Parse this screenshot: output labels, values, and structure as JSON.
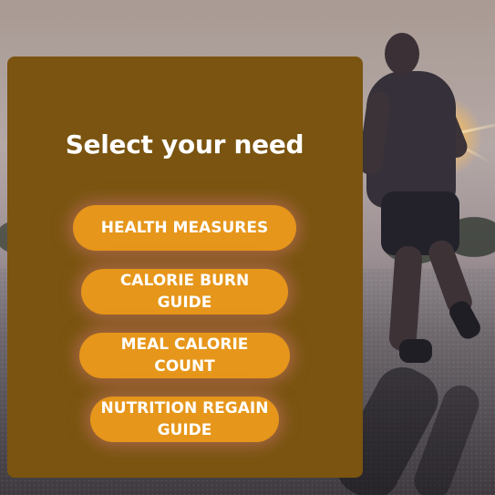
{
  "panel": {
    "title": "Select your need",
    "color": "#7a5410"
  },
  "buttons": [
    {
      "label": "HEALTH MEASURES"
    },
    {
      "label": "CALORIE BURN GUIDE"
    },
    {
      "label": "MEAL CALORIE COUNT"
    },
    {
      "label": "NUTRITION REGAIN GUIDE"
    }
  ],
  "colors": {
    "button_bg": "#e6961a",
    "button_text": "#ffffff",
    "title_text": "#ffffff"
  }
}
